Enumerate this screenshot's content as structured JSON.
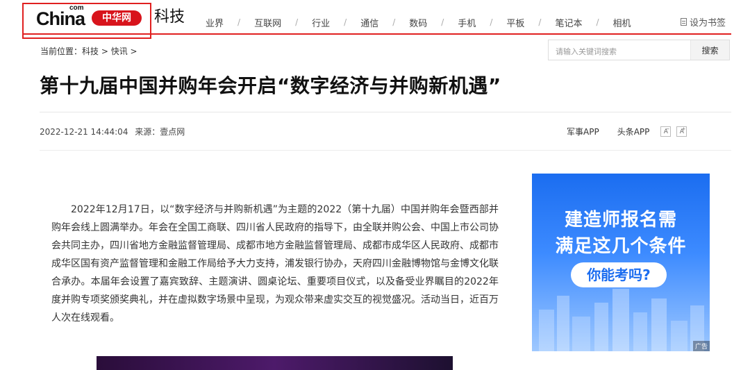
{
  "header": {
    "logo": {
      "china": "China",
      "com": "com",
      "pill": "中华网"
    },
    "section_title": "科技",
    "nav": [
      "业界",
      "互联网",
      "行业",
      "通信",
      "数码",
      "手机",
      "平板",
      "笔记本",
      "相机"
    ],
    "nav_separator": "/",
    "bookmark_label": "设为书签"
  },
  "breadcrumb": {
    "prefix": "当前位置：",
    "items": [
      "科技",
      "快讯"
    ],
    "separator": " > "
  },
  "search": {
    "placeholder": "请输入关键词搜索",
    "button_label": "搜索"
  },
  "article": {
    "title": "第十九届中国并购年会开启“数字经济与并购新机遇”",
    "datetime": "2022-12-21 14:44:04",
    "source_label": "来源：",
    "source": "壹点网",
    "app_links": [
      "军事APP",
      "头条APP"
    ],
    "font_smaller": "A",
    "font_larger": "A",
    "body": "2022年12月17日，以“数字经济与并购新机遇”为主题的2022（第十九届）中国并购年会暨西部并购年会线上圆满举办。年会在全国工商联、四川省人民政府的指导下，由全联并购公会、中国上市公司协会共同主办，四川省地方金融监督管理局、成都市地方金融监督管理局、成都市成华区人民政府、成都市成华区国有资产监督管理和金融工作局给予大力支持，浦发银行协办，天府四川金融博物馆与金博文化联合承办。本届年会设置了嘉宾致辞、主题演讲、圆桌论坛、重要项目仪式，以及备受业界瞩目的2022年度并购专项奖颁奖典礼，并在虚拟数字场景中呈现，为观众带来虚实交互的视觉盛况。活动当日，近百万人次在线观看。"
  },
  "ad": {
    "line1": "建造师报名需",
    "line2": "满足这几个条件",
    "pill": "你能考吗?",
    "tag": "广告"
  },
  "colors": {
    "brand_red": "#e02020",
    "ad_blue": "#1b6df0"
  }
}
